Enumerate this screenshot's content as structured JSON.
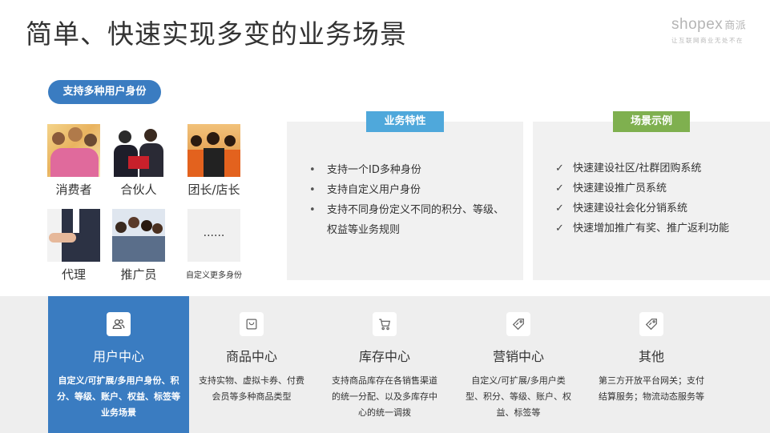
{
  "title": "简单、快速实现多变的业务场景",
  "logo": {
    "main": "shopex",
    "main_cn": "商派",
    "sub": "让互联网商业无处不在"
  },
  "identity_pill": "支持多种用户身份",
  "personas": [
    {
      "label": "消费者"
    },
    {
      "label": "合伙人"
    },
    {
      "label": "团长/店长"
    },
    {
      "label": "代理"
    },
    {
      "label": "推广员"
    },
    {
      "label": "自定义更多身份",
      "placeholder": "......"
    }
  ],
  "features": {
    "tag": "业务特性",
    "items": [
      "支持一个ID多种身份",
      "支持自定义用户身份",
      "支持不同身份定义不同的积分、等级、权益等业务规则"
    ]
  },
  "examples": {
    "tag": "场景示例",
    "items": [
      "快速建设社区/社群团购系统",
      "快速建设推广员系统",
      "快速建设社会化分销系统",
      "快速增加推广有奖、推广返利功能"
    ]
  },
  "modules": [
    {
      "title": "用户中心",
      "icon": "users-icon",
      "desc": "自定义/可扩展/多用户身份、积分、等级、账户、权益、标签等业务场景",
      "active": true
    },
    {
      "title": "商品中心",
      "icon": "bag-icon",
      "desc": "支持实物、虚拟卡券、付费会员等多种商品类型",
      "active": false
    },
    {
      "title": "库存中心",
      "icon": "cart-icon",
      "desc": "支持商品库存在各销售渠道的统一分配、以及多库存中心的统一调拨",
      "active": false
    },
    {
      "title": "营销中心",
      "icon": "tag-icon",
      "desc": "自定义/可扩展/多用户类型、积分、等级、账户、权益、标签等",
      "active": false
    },
    {
      "title": "其他",
      "icon": "tag-icon",
      "desc": "第三方开放平台网关；支付结算服务；物流动态服务等",
      "active": false
    }
  ],
  "colors": {
    "accent_blue": "#3a7cc1",
    "tag_blue": "#4fa8db",
    "tag_green": "#7fb04f",
    "panel_bg": "#f1f1f1",
    "band_bg": "#eeeeee"
  }
}
